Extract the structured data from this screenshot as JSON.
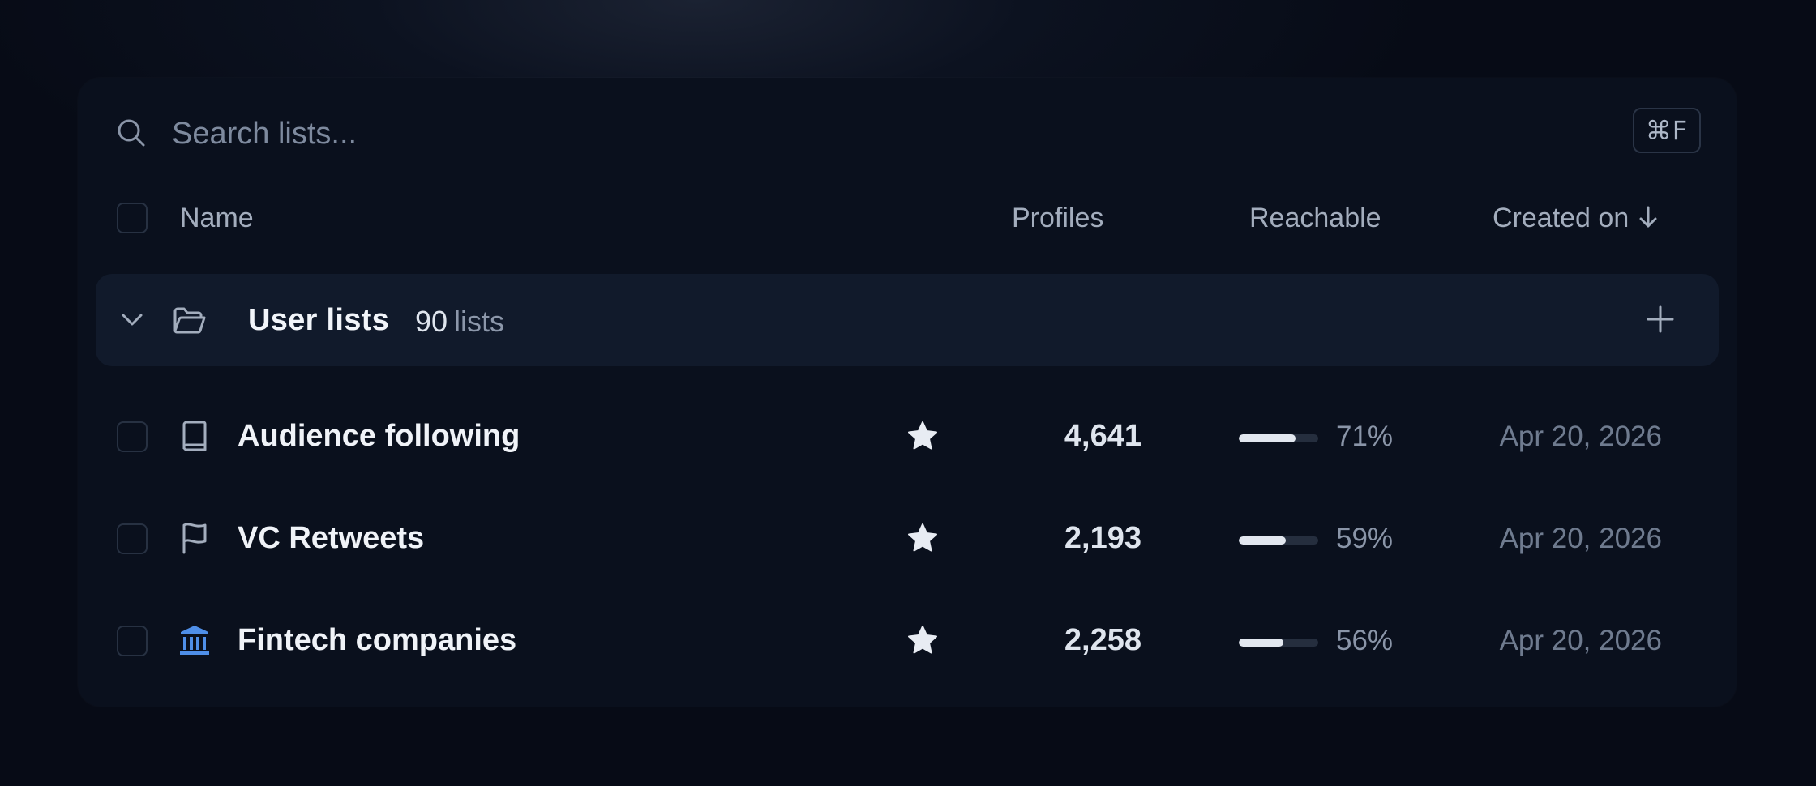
{
  "search": {
    "placeholder": "Search lists...",
    "value": "",
    "shortcut": "⌘F",
    "icon": "search-icon"
  },
  "table": {
    "headers": {
      "name": "Name",
      "profiles": "Profiles",
      "reachable": "Reachable",
      "created_on": "Created on"
    },
    "sort": {
      "column": "created_on",
      "direction": "descending",
      "icon": "arrow-down-icon"
    }
  },
  "group": {
    "title": "User lists",
    "count": "90",
    "count_unit": "lists",
    "expanded": true,
    "icons": {
      "toggle": "chevron-down-icon",
      "folder": "folder-open-icon",
      "add": "plus-icon"
    }
  },
  "rows": [
    {
      "name": "Audience following",
      "icon": "book-icon",
      "starred": true,
      "profiles": "4,641",
      "reachable_pct": "71%",
      "reachable_value": 71,
      "created_on": "Apr 20, 2026"
    },
    {
      "name": "VC Retweets",
      "icon": "flag-icon",
      "starred": true,
      "profiles": "2,193",
      "reachable_pct": "59%",
      "reachable_value": 59,
      "created_on": "Apr 20, 2026"
    },
    {
      "name": "Fintech companies",
      "icon": "bank-icon",
      "starred": true,
      "profiles": "2,258",
      "reachable_pct": "56%",
      "reachable_value": 56,
      "created_on": "Apr 20, 2026"
    }
  ],
  "colors": {
    "background": "#070b16",
    "panel": "#0a101d",
    "group_row": "#111a2b",
    "bank_icon": "#4f8fe8",
    "bar_fill": "#e2e7ef",
    "bar_track": "#252e3e"
  }
}
